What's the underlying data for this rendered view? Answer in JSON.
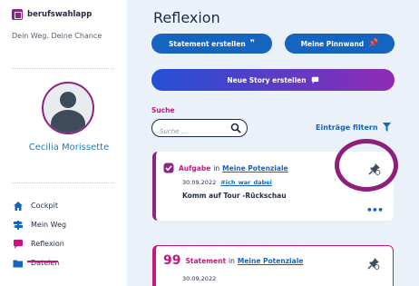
{
  "app": {
    "logo_text": "berufswahlapp",
    "tagline": "Dein Weg. Deine Chance"
  },
  "user": {
    "name": "Cecilia Morissette"
  },
  "nav": {
    "items": [
      {
        "label": "Cockpit",
        "icon": "home-icon"
      },
      {
        "label": "Mein Weg",
        "icon": "signpost-icon"
      },
      {
        "label": "Reflexion",
        "icon": "chat-icon",
        "active": true
      },
      {
        "label": "Dateien",
        "icon": "folder-icon"
      }
    ]
  },
  "page": {
    "title": "Reflexion"
  },
  "actions": {
    "statement_label": "Statement erstellen",
    "pinnwand_label": "Meine Pinnwand",
    "story_label": "Neue Story erstellen"
  },
  "search": {
    "label": "Suche",
    "placeholder": "Suche ..."
  },
  "filter": {
    "label": "Einträge filtern"
  },
  "entries": [
    {
      "type": "Aufgabe",
      "in": "in",
      "link": "Meine Potenziale",
      "date": "30.09.2022",
      "tag": "#ich_war_dabei",
      "title": "Komm auf Tour -Rückschau"
    },
    {
      "type": "Statement",
      "in": "in",
      "link": "Meine Potenziale",
      "date": "30.09.2022"
    }
  ],
  "colors": {
    "brand": "#8b2482",
    "accent": "#c8167f",
    "primary": "#1565c0",
    "background": "#eaf1f9"
  }
}
